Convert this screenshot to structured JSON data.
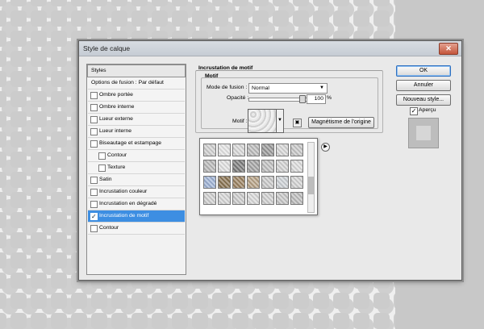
{
  "dialog": {
    "title": "Style de calque",
    "close_glyph": "✕"
  },
  "styles_panel": {
    "header": "Styles",
    "items": [
      {
        "label": "Options de fusion : Par défaut",
        "has_checkbox": false,
        "checked": false
      },
      {
        "label": "Ombre portée",
        "has_checkbox": true,
        "checked": false
      },
      {
        "label": "Ombre interne",
        "has_checkbox": true,
        "checked": false
      },
      {
        "label": "Lueur externe",
        "has_checkbox": true,
        "checked": false
      },
      {
        "label": "Lueur interne",
        "has_checkbox": true,
        "checked": false
      },
      {
        "label": "Biseautage et estampage",
        "has_checkbox": true,
        "checked": false
      },
      {
        "label": "Contour",
        "has_checkbox": true,
        "checked": false,
        "indent": true
      },
      {
        "label": "Texture",
        "has_checkbox": true,
        "checked": false,
        "indent": true
      },
      {
        "label": "Satin",
        "has_checkbox": true,
        "checked": false
      },
      {
        "label": "Incrustation couleur",
        "has_checkbox": true,
        "checked": false
      },
      {
        "label": "Incrustation en dégradé",
        "has_checkbox": true,
        "checked": false
      },
      {
        "label": "Incrustation de motif",
        "has_checkbox": true,
        "checked": true,
        "selected": true
      },
      {
        "label": "Contour",
        "has_checkbox": true,
        "checked": false
      }
    ]
  },
  "pattern_overlay": {
    "section_title": "Incrustation de motif",
    "group_title": "Motif",
    "blend_mode_label": "Mode de fusion :",
    "blend_mode_value": "Normal",
    "opacity_label": "Opacité :",
    "opacity_value": "100",
    "opacity_unit": "%",
    "pattern_label": "Motif :",
    "snap_button": "Magnétisme de l'origine"
  },
  "buttons": {
    "ok": "OK",
    "cancel": "Annuler",
    "new_style": "Nouveau style...",
    "preview_label": "Aperçu",
    "preview_checked": true
  },
  "icons": {
    "close": "close-icon",
    "dropdown": "chevron-down-icon",
    "picker_menu": "right-arrow-icon",
    "new_pattern": "new-preset-icon"
  }
}
